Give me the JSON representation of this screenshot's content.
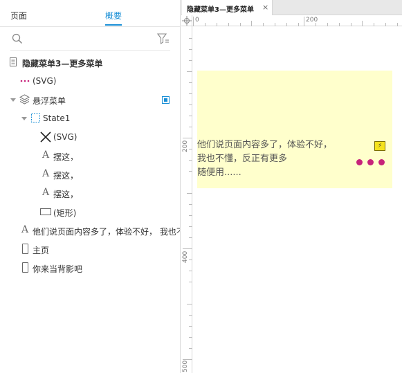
{
  "left_panel": {
    "tabs": [
      {
        "label": "页面"
      },
      {
        "label": "概要"
      }
    ],
    "active_tab": "概要",
    "tree": [
      {
        "label": "隐藏菜单3—更多菜单"
      },
      {
        "label": "(SVG)"
      },
      {
        "label": "悬浮菜单"
      },
      {
        "label": "State1"
      },
      {
        "label": "(SVG)"
      },
      {
        "label": "摆这，"
      },
      {
        "label": "摆这，"
      },
      {
        "label": "摆这，"
      },
      {
        "label": "(矩形)"
      },
      {
        "label": "他们说页面内容多了，体验不好， 我也不"
      },
      {
        "label": "主页"
      },
      {
        "label": "你来当背影吧"
      }
    ]
  },
  "right_panel": {
    "doc_tab": {
      "label": "隐藏菜单3—更多菜单",
      "close": "×"
    },
    "ruler_top": {
      "labels": [
        "0",
        "200"
      ]
    },
    "ruler_left": {
      "labels": [
        "200",
        "400",
        "500"
      ]
    },
    "canvas": {
      "note_text": "他们说页面内容多了，体验不好，\n我也不懂，反正有更多\n随便用......",
      "lightning": "⚡"
    }
  },
  "colors": {
    "accent": "#1a8fd6",
    "note_bg": "#ffffcc",
    "dots": "#c7237a",
    "svg_dots_icon": "#c7237a"
  }
}
